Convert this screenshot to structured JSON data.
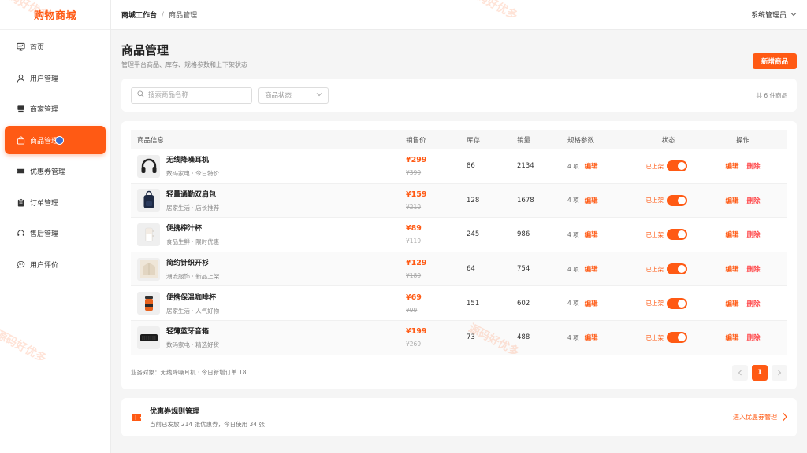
{
  "brand": "购物商城",
  "menu": [
    {
      "label": "首页",
      "icon": "monitor-icon"
    },
    {
      "label": "用户管理",
      "icon": "user-icon"
    },
    {
      "label": "商家管理",
      "icon": "store-icon"
    },
    {
      "label": "商品管理",
      "icon": "shopping-bag-icon",
      "active": true
    },
    {
      "label": "优惠券管理",
      "icon": "ticket-icon"
    },
    {
      "label": "订单管理",
      "icon": "clipboard-icon"
    },
    {
      "label": "售后管理",
      "icon": "headset-icon"
    },
    {
      "label": "用户评价",
      "icon": "chat-icon"
    }
  ],
  "breadcrumb": {
    "root": "商城工作台",
    "sep": "/",
    "current": "商品管理"
  },
  "admin": {
    "label": "系统管理员"
  },
  "page": {
    "title": "商品管理",
    "subtitle": "管理平台商品、库存、规格参数和上下架状态",
    "add_label": "新增商品"
  },
  "filter": {
    "search_placeholder": "搜索商品名称",
    "status_placeholder": "商品状态",
    "count": "共 6 件商品"
  },
  "table": {
    "columns": [
      "商品信息",
      "销售价",
      "库存",
      "销量",
      "规格参数",
      "状态",
      "操作"
    ],
    "edit_label": "编辑",
    "delete_label": "删除",
    "rows": [
      {
        "name": "无线降噪耳机",
        "meta": "数码家电 · 今日特价",
        "price": "¥299",
        "original": "¥399",
        "stock": "86",
        "sales": "2134",
        "spec": "4 项",
        "status": "已上架",
        "thumb": "headphones"
      },
      {
        "name": "轻量通勤双肩包",
        "meta": "居家生活 · 店长推荐",
        "price": "¥159",
        "original": "¥219",
        "stock": "128",
        "sales": "1678",
        "spec": "4 项",
        "status": "已上架",
        "thumb": "backpack"
      },
      {
        "name": "便携榨汁杯",
        "meta": "食品生鲜 · 限时优惠",
        "price": "¥89",
        "original": "¥119",
        "stock": "245",
        "sales": "986",
        "spec": "4 项",
        "status": "已上架",
        "thumb": "juicer"
      },
      {
        "name": "简约针织开衫",
        "meta": "潮流服饰 · 新品上架",
        "price": "¥129",
        "original": "¥189",
        "stock": "64",
        "sales": "754",
        "spec": "4 项",
        "status": "已上架",
        "thumb": "cardigan"
      },
      {
        "name": "便携保温咖啡杯",
        "meta": "居家生活 · 人气好物",
        "price": "¥69",
        "original": "¥99",
        "stock": "151",
        "sales": "602",
        "spec": "4 项",
        "status": "已上架",
        "thumb": "coffee-cup"
      },
      {
        "name": "轻薄蓝牙音箱",
        "meta": "数码家电 · 精选好货",
        "price": "¥199",
        "original": "¥269",
        "stock": "73",
        "sales": "488",
        "spec": "4 项",
        "status": "已上架",
        "thumb": "speaker"
      }
    ]
  },
  "footer": {
    "biz": "业务对象：无线降噪耳机 · 今日新增订单 18",
    "page": "1"
  },
  "coupon": {
    "title": "优惠券规则管理",
    "desc": "当前已发放 214 张优惠券，今日使用 34 张",
    "link": "进入优惠券管理"
  },
  "watermark": "源码好优多",
  "colors": {
    "accent": "#ff5a14",
    "danger": "#ff4d4f",
    "notification_dot": "#3f6fcf"
  }
}
